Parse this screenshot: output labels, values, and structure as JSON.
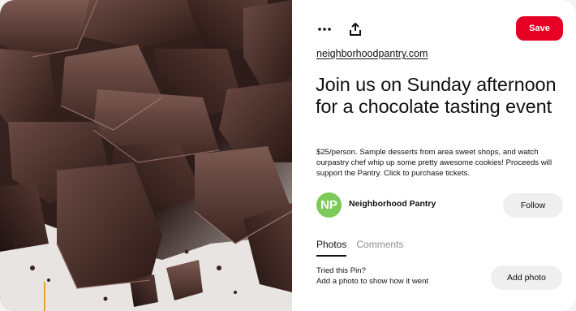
{
  "pin": {
    "image_alt": "Broken chocolate pieces",
    "save_label": "Save",
    "more_icon": "more-dots-icon",
    "share_icon": "share-upload-icon",
    "source_link": "neighborhoodpantry.com",
    "title": "Join us on Sunday afternoon for a chocolate tasting event",
    "description": "$25/person. Sample desserts from area sweet shops, and watch ourpastry chef whip up some pretty awesome cookies! Proceeds will support the Pantry. Click to purchase tickets.",
    "colors": {
      "save": "#e60023",
      "avatar": "#7ccb5a",
      "button_gray": "#efefef"
    }
  },
  "profile": {
    "initials": "NP",
    "name": "Neighborhood Pantry",
    "follow_label": "Follow"
  },
  "tabs": [
    {
      "label": "Photos",
      "active": true
    },
    {
      "label": "Comments",
      "active": false
    }
  ],
  "tried": {
    "title": "Tried this Pin?",
    "subtitle": "Add a photo to show how it went",
    "add_photo_label": "Add photo"
  }
}
